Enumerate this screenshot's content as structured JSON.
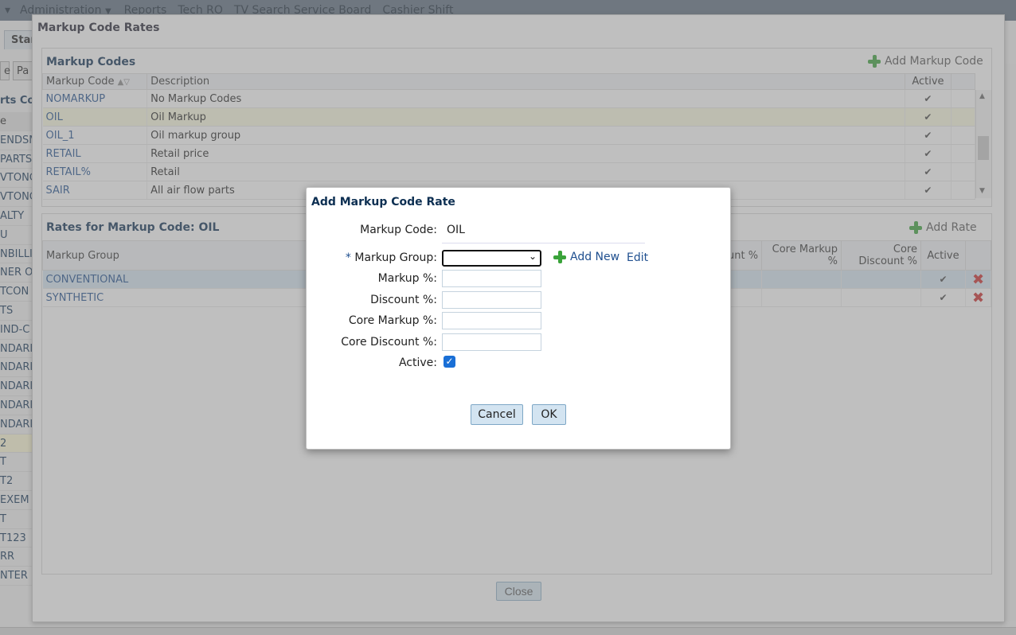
{
  "menubar": {
    "items": [
      "Administration",
      "Reports",
      "Tech RO",
      "TV Search Service Board",
      "Cashier Shift"
    ]
  },
  "background": {
    "tab": "Star",
    "btn1": "e",
    "btn2": "Pa",
    "parts_title": "rts Co",
    "list": [
      "e",
      "ENDSM",
      "PARTS",
      "VTONC",
      "VTONC",
      "ALTY",
      "U",
      "NBILLI",
      "NER O",
      "TCON",
      "TS",
      "IND-C",
      "NDARI",
      "NDARI",
      "NDARI",
      "NDARI",
      "NDARI",
      "",
      "2",
      "T",
      "T2",
      "EXEM",
      "T",
      "T123",
      "RR",
      "NTER"
    ]
  },
  "window": {
    "title": "Markup Code Rates",
    "close_label": "Close",
    "markup_codes": {
      "title": "Markup Codes",
      "add_label": "Add Markup Code",
      "columns": [
        "Markup Code",
        "Description",
        "Active"
      ],
      "rows": [
        {
          "code": "NOMARKUP",
          "desc": "No Markup Codes"
        },
        {
          "code": "OIL",
          "desc": "Oil Markup"
        },
        {
          "code": "OIL_1",
          "desc": "Oil markup group"
        },
        {
          "code": "RETAIL",
          "desc": "Retail price"
        },
        {
          "code": "RETAIL%",
          "desc": "Retail"
        },
        {
          "code": "SAIR",
          "desc": "All air flow parts"
        }
      ]
    },
    "rates": {
      "title": "Rates for Markup Code: OIL",
      "add_label": "Add Rate",
      "columns": [
        "Markup Group",
        "unt %",
        "Core Markup %",
        "Core Discount %",
        "Active"
      ],
      "rows": [
        {
          "group": "CONVENTIONAL"
        },
        {
          "group": "SYNTHETIC"
        }
      ]
    }
  },
  "dialog": {
    "title": "Add Markup Code Rate",
    "markup_code_label": "Markup Code:",
    "markup_code_value": "OIL",
    "required_mark": "*",
    "markup_group_label": "Markup Group:",
    "add_new_label": "Add New",
    "edit_label": "Edit",
    "markup_pct_label": "Markup %:",
    "discount_pct_label": "Discount %:",
    "core_markup_pct_label": "Core Markup %:",
    "core_discount_pct_label": "Core Discount %:",
    "active_label": "Active:",
    "active_checked": true,
    "cancel_label": "Cancel",
    "ok_label": "OK"
  }
}
